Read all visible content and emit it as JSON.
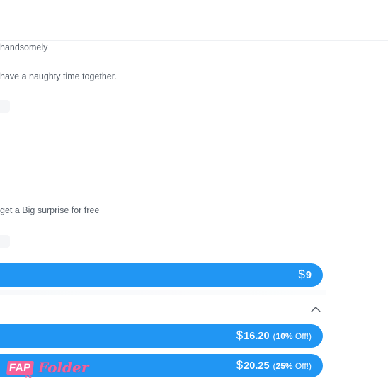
{
  "content": {
    "line1": "handsomely",
    "line2": "have a naughty time together.",
    "line3": "get a Big surprise for free"
  },
  "pricing": {
    "currency_symbol": "$",
    "options": [
      {
        "amount": "9",
        "discount": ""
      },
      {
        "amount": "16.20",
        "discount_pct": "10%",
        "discount_suffix": " Off!"
      },
      {
        "amount": "20.25",
        "discount_pct": "25%",
        "discount_suffix": " Off!"
      }
    ]
  },
  "icons": {
    "collapse": "chevron-up-icon"
  },
  "logo": {
    "primary": "FAP",
    "secondary": "Folder",
    "tiny": "FS"
  },
  "colors": {
    "accent": "#2196f3",
    "text": "#59616b",
    "logo": "#f4619a"
  }
}
